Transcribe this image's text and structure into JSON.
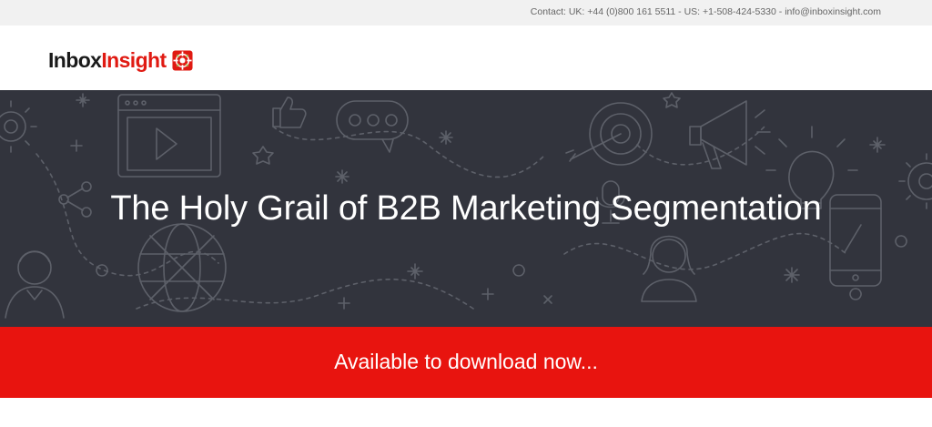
{
  "topbar": {
    "contact": "Contact: UK: +44 (0)800 161 5511 - US: +1-508-424-5330 - info@inboxinsight.com"
  },
  "header": {
    "logo": {
      "part1": "Inbox",
      "part2": "Insight",
      "icon": "crosshair-logo-icon"
    }
  },
  "hero": {
    "title": "The Holy Grail of B2B Marketing Segmentation",
    "background_icons": [
      "gear-icon",
      "video-player-icon",
      "thumbs-up-icon",
      "chat-bubble-icon",
      "target-icon",
      "megaphone-icon",
      "lightbulb-icon",
      "smartphone-icon",
      "globe-icon",
      "person-icon",
      "share-icon",
      "microphone-icon"
    ]
  },
  "cta": {
    "text": "Available to download now..."
  },
  "colors": {
    "brand_red": "#e01a12",
    "cta_red": "#e8140f",
    "hero_bg": "#32343d",
    "topbar_bg": "#f1f1f1"
  }
}
